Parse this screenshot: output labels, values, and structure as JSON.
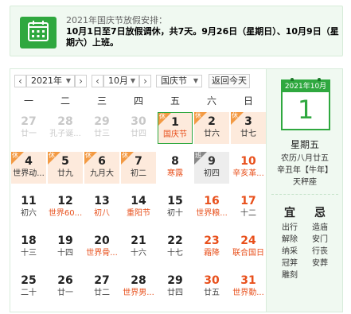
{
  "notice": {
    "title": "2021年国庆节放假安排：",
    "body": "10月1日至7日放假调休，共7天。9月26日（星期日）、10月9日（星期六）上班。",
    "icon": "calendar-icon"
  },
  "toolbar": {
    "prev_year": "‹",
    "year_value": "2021年",
    "next_year": "›",
    "prev_month": "‹",
    "month_value": "10月",
    "next_month": "›",
    "holiday_value": "国庆节",
    "today_button": "返回今天"
  },
  "weekdays": [
    "一",
    "二",
    "三",
    "四",
    "五",
    "六",
    "日"
  ],
  "days": [
    {
      "num": "27",
      "lunar": "廿一",
      "state": "other"
    },
    {
      "num": "28",
      "lunar": "孔子诞...",
      "state": "other"
    },
    {
      "num": "29",
      "lunar": "廿三",
      "state": "other"
    },
    {
      "num": "30",
      "lunar": "廿四",
      "state": "other"
    },
    {
      "num": "1",
      "lunar": "国庆节",
      "state": "today",
      "badge": "休"
    },
    {
      "num": "2",
      "lunar": "廿六",
      "state": "holiday",
      "badge": "休"
    },
    {
      "num": "3",
      "lunar": "廿七",
      "state": "holiday",
      "badge": "休"
    },
    {
      "num": "4",
      "lunar": "世界动...",
      "state": "holiday",
      "badge": "休"
    },
    {
      "num": "5",
      "lunar": "廿九",
      "state": "holiday",
      "badge": "休"
    },
    {
      "num": "6",
      "lunar": "九月大",
      "state": "holiday",
      "badge": "休"
    },
    {
      "num": "7",
      "lunar": "初二",
      "state": "holiday",
      "badge": "休"
    },
    {
      "num": "8",
      "lunar": "寒露",
      "state": "festival"
    },
    {
      "num": "9",
      "lunar": "初四",
      "state": "workday",
      "badge": "班"
    },
    {
      "num": "10",
      "lunar": "辛亥革...",
      "state": "weekend-festival"
    },
    {
      "num": "11",
      "lunar": "初六",
      "state": "normal"
    },
    {
      "num": "12",
      "lunar": "世界60...",
      "state": "festival"
    },
    {
      "num": "13",
      "lunar": "初八",
      "state": "festival"
    },
    {
      "num": "14",
      "lunar": "重阳节",
      "state": "festival"
    },
    {
      "num": "15",
      "lunar": "初十",
      "state": "normal"
    },
    {
      "num": "16",
      "lunar": "世界粮...",
      "state": "weekend-festival"
    },
    {
      "num": "17",
      "lunar": "十二",
      "state": "weekend"
    },
    {
      "num": "18",
      "lunar": "十三",
      "state": "normal"
    },
    {
      "num": "19",
      "lunar": "十四",
      "state": "normal"
    },
    {
      "num": "20",
      "lunar": "世界骨...",
      "state": "festival"
    },
    {
      "num": "21",
      "lunar": "十六",
      "state": "normal"
    },
    {
      "num": "22",
      "lunar": "十七",
      "state": "normal"
    },
    {
      "num": "23",
      "lunar": "霜降",
      "state": "weekend-festival"
    },
    {
      "num": "24",
      "lunar": "联合国日",
      "state": "weekend-festival"
    },
    {
      "num": "25",
      "lunar": "二十",
      "state": "normal"
    },
    {
      "num": "26",
      "lunar": "廿一",
      "state": "normal"
    },
    {
      "num": "27",
      "lunar": "廿二",
      "state": "normal"
    },
    {
      "num": "28",
      "lunar": "世界男...",
      "state": "festival"
    },
    {
      "num": "29",
      "lunar": "廿四",
      "state": "normal"
    },
    {
      "num": "30",
      "lunar": "廿五",
      "state": "weekend"
    },
    {
      "num": "31",
      "lunar": "世界勤...",
      "state": "weekend-festival"
    }
  ],
  "detail": {
    "year_month": "2021年10月",
    "day": "1",
    "weekday": "星期五",
    "lunar_date": "农历八月廿五",
    "ganzhi": "辛丑年【牛年】",
    "constellation": "天秤座",
    "yi_title": "宜",
    "ji_title": "忌",
    "yi_items": [
      "出行",
      "解除",
      "纳采",
      "冠笄",
      "雕刻"
    ],
    "ji_items": [
      "造庙",
      "安门",
      "行丧",
      "安葬"
    ]
  },
  "colors": {
    "accent": "#2fa83f",
    "holiday_bg": "#fdeadc",
    "holiday_badge": "#f39a43",
    "weekend_red": "#e8501c"
  }
}
